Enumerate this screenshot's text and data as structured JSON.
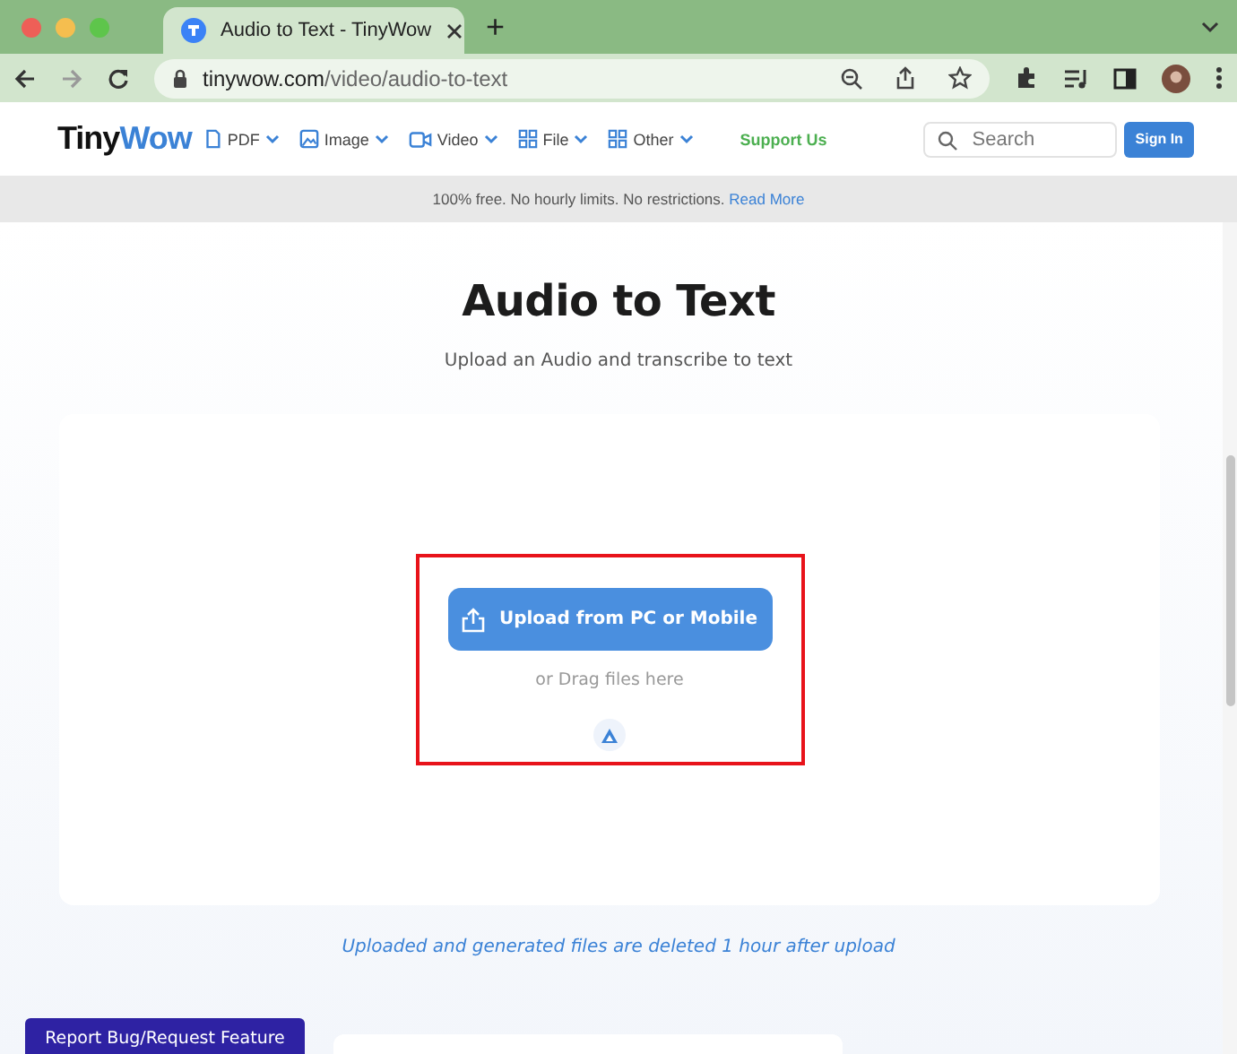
{
  "browser": {
    "tab": {
      "title": "Audio to Text - TinyWow",
      "selected": true
    },
    "new_tab": "+",
    "url": {
      "host": "tinywow.com",
      "path": "/video/audio-to-text"
    }
  },
  "header": {
    "logo": {
      "first": "Tiny",
      "second": "Wow"
    },
    "nav": [
      {
        "label": "PDF",
        "kind": "pdf"
      },
      {
        "label": "Image",
        "kind": "image"
      },
      {
        "label": "Video",
        "kind": "video"
      },
      {
        "label": "File",
        "kind": "grid"
      },
      {
        "label": "Other",
        "kind": "grid"
      }
    ],
    "support": "Support Us",
    "search": {
      "placeholder": "Search"
    },
    "sign_in": "Sign In"
  },
  "banner": {
    "text": "100% free. No hourly limits. No restrictions.",
    "link": "Read More"
  },
  "main": {
    "title": "Audio to Text",
    "subtitle": "Upload an Audio and transcribe to text",
    "upload": {
      "button": "Upload from PC or Mobile",
      "hint": "or Drag files here",
      "highlighted": true
    },
    "note": "Uploaded and generated files are deleted 1 hour after upload"
  },
  "report_button": "Report Bug/Request Feature"
}
